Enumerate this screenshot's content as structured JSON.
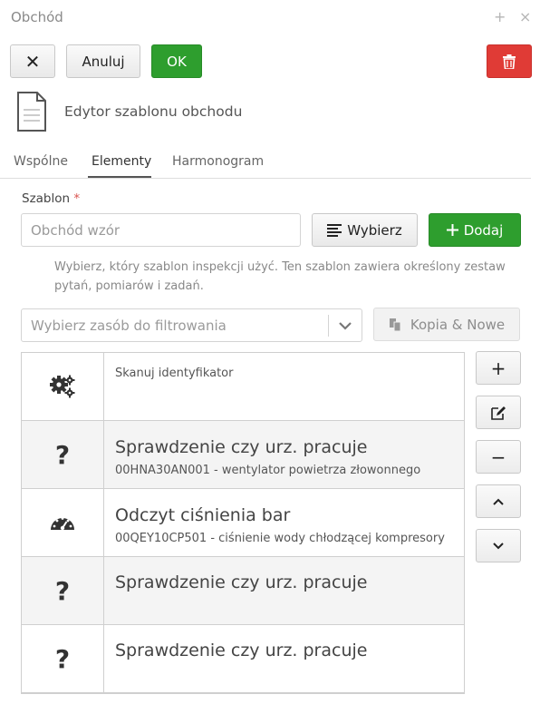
{
  "window": {
    "title": "Obchód",
    "plus_glyph": "+",
    "close_glyph": "×"
  },
  "toolbar": {
    "close_label": "✕",
    "cancel_label": "Anuluj",
    "ok_label": "OK",
    "delete_icon": "trash-icon"
  },
  "header": {
    "title": "Edytor szablonu obchodu",
    "icon": "document-icon"
  },
  "tabs": [
    {
      "label": "Wspólne",
      "active": false
    },
    {
      "label": "Elementy",
      "active": true
    },
    {
      "label": "Harmonogram",
      "active": false
    }
  ],
  "template_field": {
    "label": "Szablon",
    "required_mark": "*",
    "placeholder": "Obchód wzór",
    "choose_label": "Wybierz",
    "add_label": "Dodaj",
    "help": "Wybierz, który szablon inspekcji użyć. Ten szablon zawiera określony zestaw pytań, pomiarów i zadań."
  },
  "filter": {
    "placeholder": "Wybierz zasób do filtrowania",
    "copy_label": "Kopia & Nowe"
  },
  "items": [
    {
      "icon": "gears-icon",
      "title": "Skanuj identyfikator",
      "subtitle": ""
    },
    {
      "icon": "question-icon",
      "title": "Sprawdzenie czy urz. pracuje",
      "subtitle": "00HNA30AN001 - wentylator powietrza złowonnego"
    },
    {
      "icon": "gauge-icon",
      "title": "Odczyt ciśnienia bar",
      "subtitle": "00QEY10CP501 - ciśnienie wody chłodzącej kompresory"
    },
    {
      "icon": "question-icon",
      "title": "Sprawdzenie czy urz. pracuje",
      "subtitle": ""
    },
    {
      "icon": "question-icon",
      "title": "Sprawdzenie czy urz. pracuje",
      "subtitle": ""
    }
  ],
  "side_buttons": {
    "add": "+",
    "edit_icon": "edit-icon",
    "remove": "−",
    "up_icon": "chevron-up-icon",
    "down_icon": "chevron-down-icon"
  }
}
